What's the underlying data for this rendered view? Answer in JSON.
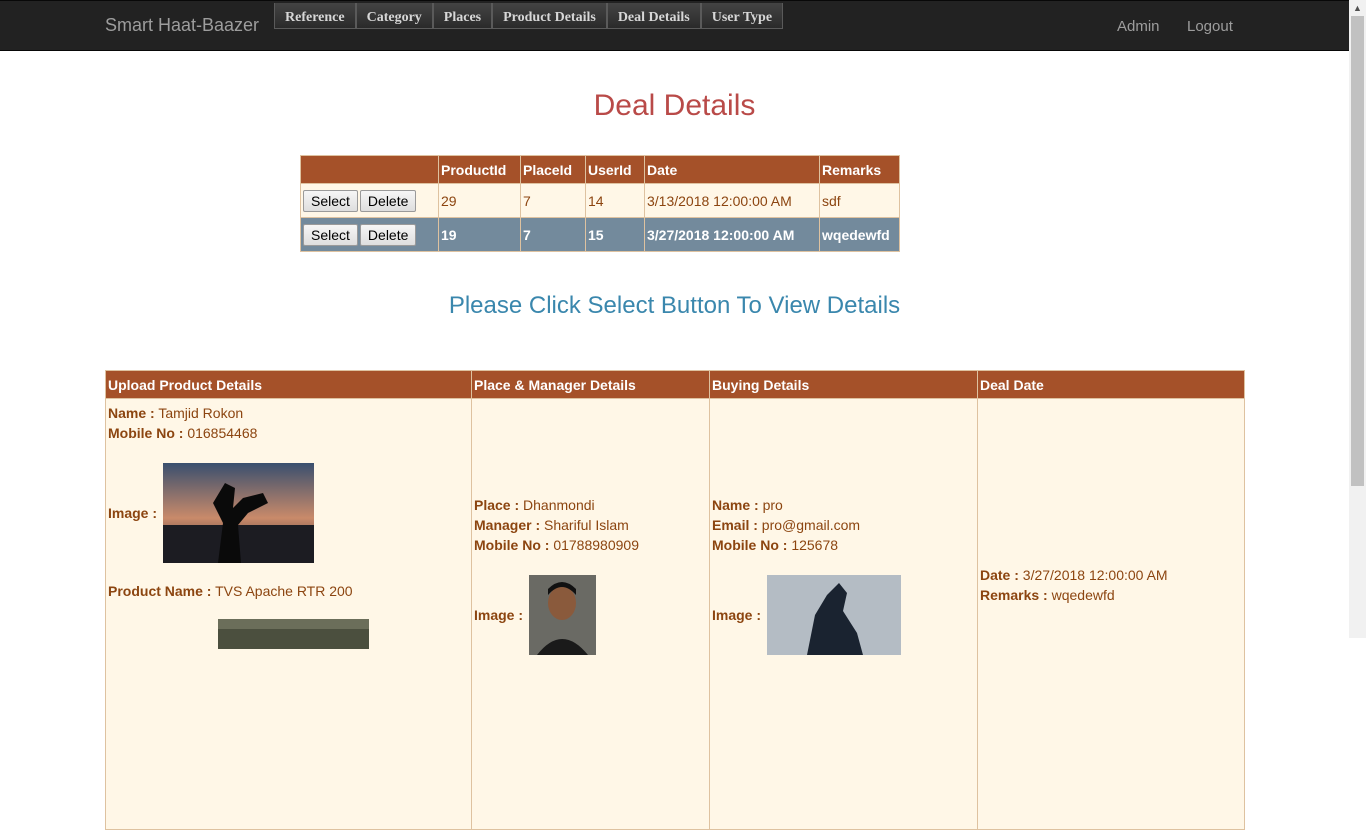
{
  "navbar": {
    "brand": "Smart Haat-Baazer",
    "menu": [
      "Reference",
      "Category",
      "Places",
      "Product Details",
      "Deal Details",
      "User Type"
    ],
    "right": [
      "Admin",
      "Logout"
    ]
  },
  "page": {
    "title": "Deal Details",
    "hint": "Please Click Select Button To View Details"
  },
  "grid": {
    "select_label": "Select",
    "delete_label": "Delete",
    "headers": [
      "",
      "ProductId",
      "PlaceId",
      "UserId",
      "Date",
      "Remarks"
    ],
    "rows": [
      {
        "ProductId": "29",
        "PlaceId": "7",
        "UserId": "14",
        "Date": "3/13/2018 12:00:00 AM",
        "Remarks": "sdf"
      },
      {
        "ProductId": "19",
        "PlaceId": "7",
        "UserId": "15",
        "Date": "3/27/2018 12:00:00 AM",
        "Remarks": "wqedewfd"
      }
    ],
    "selected_row": 1
  },
  "detail": {
    "headers": [
      "Upload Product Details",
      "Place & Manager Details",
      "Buying Details",
      "Deal Date"
    ],
    "upload": {
      "name_label": "Name :",
      "name": "Tamjid Rokon",
      "mobile_label": "Mobile No :",
      "mobile": "016854468",
      "image_label": "Image :",
      "product_label": "Product Name :",
      "product": "TVS Apache RTR 200"
    },
    "place": {
      "place_label": "Place :",
      "place": "Dhanmondi",
      "manager_label": "Manager :",
      "manager": "Shariful Islam",
      "mobile_label": "Mobile No :",
      "mobile": "01788980909",
      "image_label": "Image :"
    },
    "buying": {
      "name_label": "Name :",
      "name": "pro",
      "email_label": "Email :",
      "email": "pro@gmail.com",
      "mobile_label": "Mobile No :",
      "mobile": "125678",
      "image_label": "Image :"
    },
    "deal": {
      "date_label": "Date :",
      "date": "3/27/2018 12:00:00 AM",
      "remarks_label": "Remarks :",
      "remarks": "wqedewfd"
    }
  }
}
